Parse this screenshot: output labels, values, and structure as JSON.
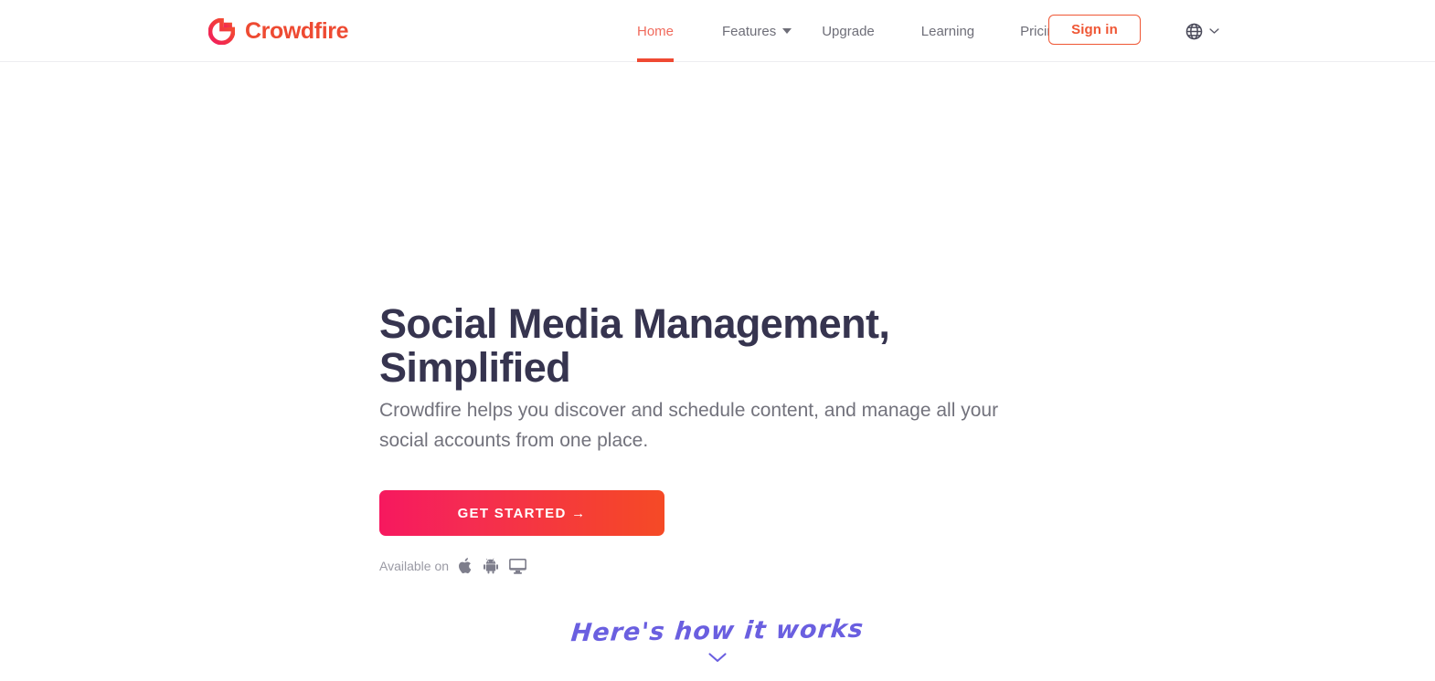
{
  "header": {
    "logo": {
      "mark_icon": "crowdfire-circle-logo-icon",
      "text": "Crowdfire"
    },
    "nav": [
      {
        "label": "Home",
        "active": true,
        "has_caret": false
      },
      {
        "label": "Features",
        "active": false,
        "has_caret": true
      },
      {
        "label": "Upgrade",
        "active": false,
        "has_caret": false
      },
      {
        "label": "Learning",
        "active": false,
        "has_caret": false
      },
      {
        "label": "Pricing",
        "active": false,
        "has_caret": false
      }
    ],
    "signin_label": "Sign in",
    "language": {
      "icon": "globe-icon",
      "chevron": "chevron-down-icon"
    }
  },
  "hero": {
    "title": "Social Media Management,\nSimplified",
    "subtitle": "Crowdfire helps you discover and schedule content, and manage all your\nsocial accounts from one place.",
    "cta_label": "GET STARTED →",
    "available": {
      "label": "Available on",
      "platforms": [
        {
          "name": "apple-icon"
        },
        {
          "name": "android-icon"
        },
        {
          "name": "desktop-monitor-icon"
        }
      ]
    },
    "how_it_works": {
      "text": "Here's how it works",
      "chevron": "chevron-down-icon"
    }
  },
  "colors": {
    "brand_red": "#ef4a33",
    "signin_border": "#ef5634",
    "nav_active": "#f06a5c",
    "nav_default": "#6e6e78",
    "title": "#36344f",
    "subtitle": "#72727c",
    "cta_gradient_start": "#f6185f",
    "cta_gradient_end": "#f54a26",
    "handwriting_purple": "#6a5fe0",
    "muted": "#9a9aa4"
  }
}
